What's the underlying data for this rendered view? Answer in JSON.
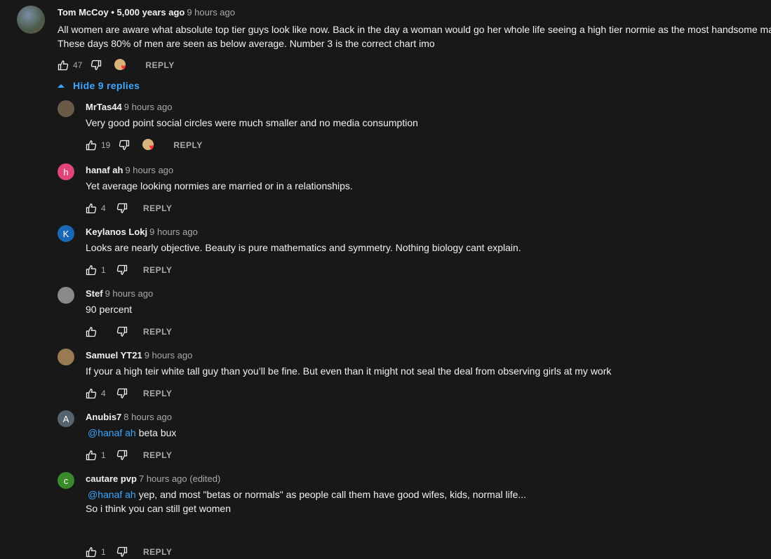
{
  "main_comment": {
    "author": "Tom McCoy • 5,000 years ago",
    "time": "9 hours ago",
    "text_line1": "All women are aware what absolute top tier guys look like now. Back in the day a woman would go her whole life seeing a high tier normie as the most handsome man",
    "text_line2": "These days 80% of men are seen as below average. Number 3 is the correct chart imo",
    "likes": "47",
    "reply_label": "REPLY"
  },
  "hide_replies_label": "Hide 9 replies",
  "replies": [
    {
      "author": "MrTas44",
      "time": "9 hours ago",
      "text": "Very good point social circles were much smaller and no media consumption",
      "likes": "19",
      "avatar_letter": "",
      "avatar_color": "#6b5a48"
    },
    {
      "author": "hanaf ah",
      "time": "9 hours ago",
      "text": "Yet average looking normies are married or in a relationships.",
      "likes": "4",
      "avatar_letter": "h",
      "avatar_color": "#e0457a"
    },
    {
      "author": "Keylanos Lokj",
      "time": "9 hours ago",
      "text": "Looks are nearly objective. Beauty is pure mathematics and symmetry. Nothing biology cant explain.",
      "likes": "1",
      "avatar_letter": "K",
      "avatar_color": "#1a67b8"
    },
    {
      "author": "Stef",
      "time": "9 hours ago",
      "text": "90 percent",
      "likes": "",
      "avatar_letter": "",
      "avatar_color": "#8a8a8a"
    },
    {
      "author": "Samuel YT21",
      "time": "9 hours ago",
      "text": "If your a high teir white tall guy than you’ll be fine. But even than it might not seal the deal from observing girls at my work",
      "likes": "4",
      "avatar_letter": "",
      "avatar_color": "#9a7a52"
    },
    {
      "author": "Anubis7",
      "time": "8 hours ago",
      "mention": "@hanaf ah",
      "text": "beta bux",
      "likes": "1",
      "avatar_letter": "A",
      "avatar_color": "#56646f"
    },
    {
      "author": "cautare pvp",
      "time": "7 hours ago (edited)",
      "mention": "@hanaf ah",
      "text": "yep, and most \"betas or normals\" as people call them have good wifes, kids, normal life...",
      "text2": "So i think you can still get women",
      "likes": "1",
      "avatar_letter": "c",
      "avatar_color": "#3a8a2a"
    }
  ],
  "reply_label": "REPLY",
  "colors": {
    "background": "#181818",
    "link": "#3ea6ff",
    "secondary_text": "#aaaaaa",
    "heart": "#ff2e3b"
  }
}
